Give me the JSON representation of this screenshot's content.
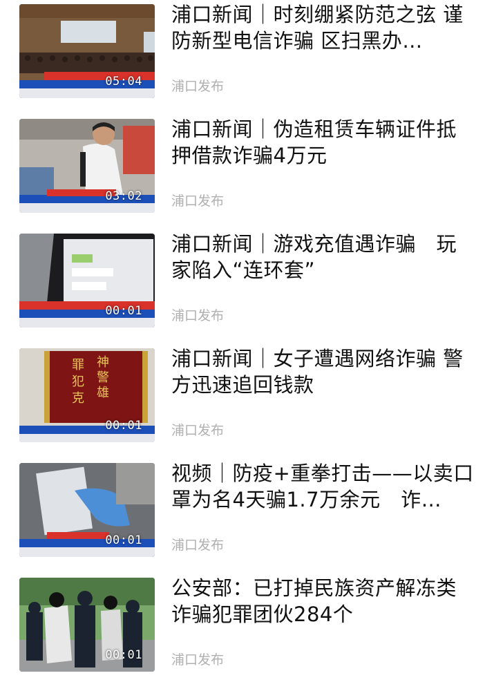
{
  "feed": {
    "items": [
      {
        "title": "浦口新闻｜时刻绷紧防范之弦 谨防新型电信诈骗 区扫黑办…",
        "source": "浦口发布",
        "duration": "05:04",
        "thumb_icon": "auditorium-meeting-thumbnail"
      },
      {
        "title": "浦口新闻｜伪造租赁车辆证件抵押借款诈骗4万元",
        "source": "浦口发布",
        "duration": "03:02",
        "thumb_icon": "man-interview-thumbnail"
      },
      {
        "title": "浦口新闻｜游戏充值遇诈骗　玩家陷入“连环套”",
        "source": "浦口发布",
        "duration": "00:01",
        "thumb_icon": "phone-chat-thumbnail"
      },
      {
        "title": "浦口新闻｜女子遭遇网络诈骗 警方迅速追回钱款",
        "source": "浦口发布",
        "duration": "00:01",
        "thumb_icon": "banner-pennant-thumbnail"
      },
      {
        "title": "视频｜防疫+重拳打击——以卖口罩为名4天骗1.7万余元　诈…",
        "source": "浦口发布",
        "duration": "00:01",
        "thumb_icon": "gloved-hand-phone-thumbnail"
      },
      {
        "title": "公安部：已打掉民族资产解冻类诈骗犯罪团伙284个",
        "source": "浦口发布",
        "duration": "00:01",
        "thumb_icon": "police-arrest-thumbnail"
      }
    ]
  }
}
